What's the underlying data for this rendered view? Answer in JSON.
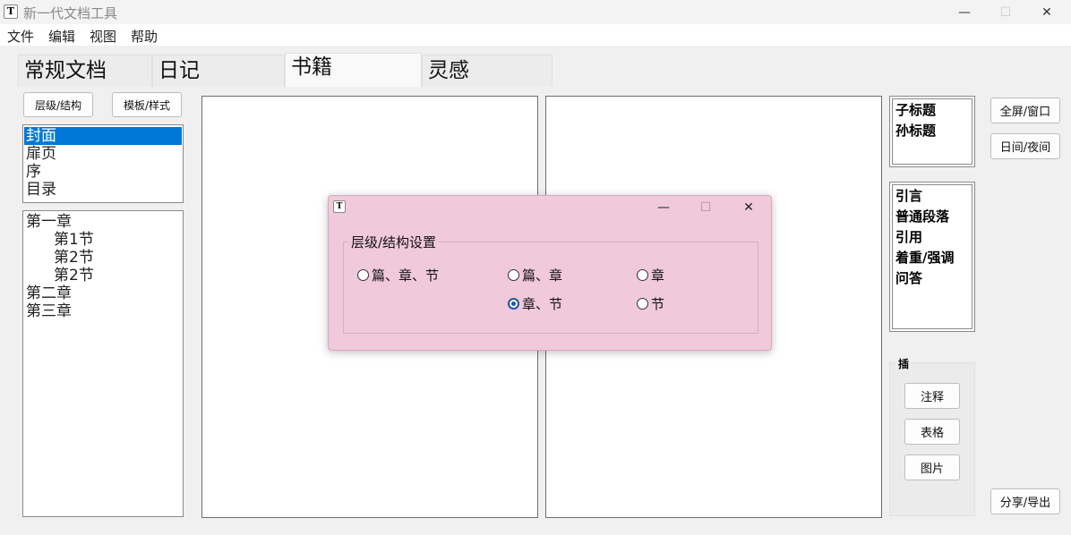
{
  "window": {
    "title": "新一代文档工具",
    "icon_glyph": "T",
    "minimize": "—",
    "maximize": "☐",
    "close": "✕"
  },
  "menu": [
    "文件",
    "编辑",
    "视图",
    "帮助"
  ],
  "tabs": [
    {
      "label": "常规文档",
      "active": false
    },
    {
      "label": "日记",
      "active": false
    },
    {
      "label": "书籍",
      "active": true
    },
    {
      "label": "灵感",
      "active": false
    }
  ],
  "left_panel": {
    "structure_button": "层级/结构",
    "template_button": "模板/样式",
    "front_matter": [
      {
        "label": "封面",
        "selected": true
      },
      {
        "label": "扉页",
        "selected": false
      },
      {
        "label": "序",
        "selected": false
      },
      {
        "label": "目录",
        "selected": false
      }
    ],
    "outline": [
      {
        "label": "第一章",
        "level": 0
      },
      {
        "label": "第1节",
        "level": 1
      },
      {
        "label": "第2节",
        "level": 1
      },
      {
        "label": "第2节",
        "level": 1
      },
      {
        "label": "第二章",
        "level": 0
      },
      {
        "label": "第三章",
        "level": 0
      }
    ]
  },
  "right_panel": {
    "heading_styles": [
      "子标题",
      "孙标题"
    ],
    "paragraph_styles": [
      "引言",
      "普通段落",
      "引用",
      "着重/强调",
      "问答"
    ],
    "insert_group_label": "插",
    "insert_buttons": [
      "注释",
      "表格",
      "图片"
    ],
    "fullscreen_button": "全屏/窗口",
    "daynight_button": "日间/夜间",
    "share_button": "分享/导出"
  },
  "dialog": {
    "icon_glyph": "T",
    "minimize": "—",
    "maximize": "☐",
    "close": "✕",
    "group_label": "层级/结构设置",
    "options": [
      {
        "label": "篇、章、节",
        "checked": false
      },
      {
        "label": "篇、章",
        "checked": false
      },
      {
        "label": "章",
        "checked": false
      },
      {
        "label": "章、节",
        "checked": true
      },
      {
        "label": "节",
        "checked": false
      }
    ]
  }
}
